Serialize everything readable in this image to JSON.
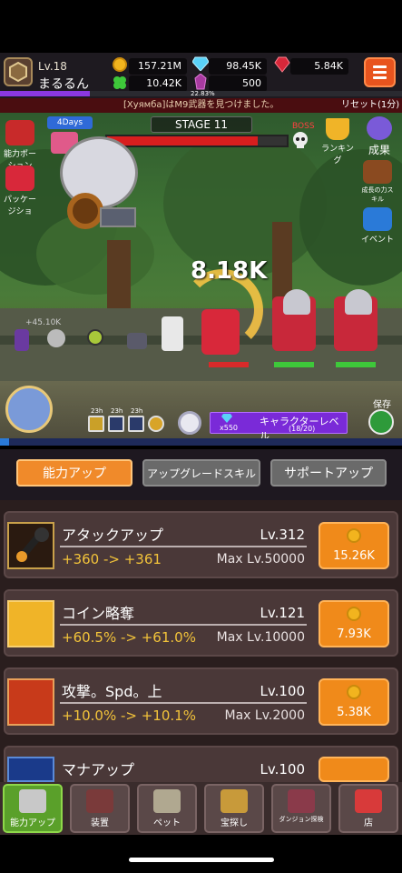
{
  "player": {
    "level": "Lv.18",
    "name": "まるるん"
  },
  "resources": {
    "coins": "157.21M",
    "gems": "98.45K",
    "rubies": "5.84K",
    "clover": "10.42K",
    "crystal": "500"
  },
  "xp_percent": "22.83%",
  "ticker": {
    "message": "[Хуямба]はM9武器を見つけました。",
    "reset": "リセット(1分)"
  },
  "battle": {
    "stage": "STAGE 11",
    "boss_label": "BOSS",
    "damage": "8.18K",
    "dps": "+45.10K",
    "days_badge": "4Days",
    "boss_hp_fraction": 0.84
  },
  "side_left": [
    {
      "label": "能力ポーション"
    },
    {
      "label": "パッケージショ"
    }
  ],
  "side_right": [
    {
      "label": "ランキング"
    },
    {
      "label": "成果"
    },
    {
      "label": "成長の力スキル"
    },
    {
      "label": "イベント"
    }
  ],
  "skills": [
    {
      "time": "23h"
    },
    {
      "time": "23h"
    },
    {
      "time": "23h"
    }
  ],
  "char_level": {
    "label": "キャラクターレベル",
    "progress": "(18/20)",
    "cost": "x550"
  },
  "save_label": "保存",
  "tabs": [
    {
      "label": "能力アップ"
    },
    {
      "label": "アップグレードスキル"
    },
    {
      "label": "サポートアップ"
    }
  ],
  "upgrades": [
    {
      "name": "アタックアップ",
      "level": "Lv.312",
      "value": "+360 -> +361",
      "max": "Max  Lv.50000",
      "cost": "15.26K"
    },
    {
      "name": "コイン略奪",
      "level": "Lv.121",
      "value": "+60.5% -> +61.0%",
      "max": "Max  Lv.10000",
      "cost": "7.93K"
    },
    {
      "name": "攻撃。Spd。上",
      "level": "Lv.100",
      "value": "+10.0% -> +10.1%",
      "max": "Max  Lv.2000",
      "cost": "5.38K"
    },
    {
      "name": "マナアップ",
      "level": "Lv.100",
      "value": "",
      "max": "",
      "cost": ""
    }
  ],
  "nav": [
    {
      "label": "能力アップ"
    },
    {
      "label": "装置"
    },
    {
      "label": "ペット"
    },
    {
      "label": "宝探し"
    },
    {
      "label": "ダンジョン探検"
    },
    {
      "label": "店"
    }
  ]
}
